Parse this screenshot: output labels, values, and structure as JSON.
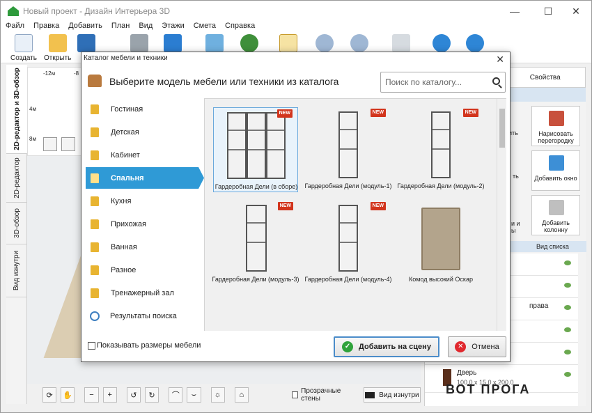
{
  "window": {
    "title": "Новый проект - Дизайн Интерьера 3D"
  },
  "menu": [
    "Файл",
    "Правка",
    "Добавить",
    "План",
    "Вид",
    "Этажи",
    "Смета",
    "Справка"
  ],
  "toolbar": {
    "create": "Создать",
    "open": "Открыть",
    "save_partial": "С"
  },
  "left_tabs": [
    "2D-редактор и 3D-обзор",
    "2D-редактор",
    "3D-обзор",
    "Вид изнутри"
  ],
  "ruler": {
    "x1": "-12м",
    "x2": "-8",
    "y1": "4м",
    "y2": "8м"
  },
  "bottom": {
    "transparent_walls": "Прозрачные стены",
    "inside_view": "Вид изнутри"
  },
  "right_panel": {
    "tab_properties": "Свойства",
    "btn_draw": "Нарисовать перегородку",
    "btn_window": "Добавить окно",
    "btn_column": "Добавить колонну",
    "partial_1": "ить",
    "partial_2": "ть",
    "partial_3": "и и",
    "partial_4": "ы",
    "list_view": "Вид списка",
    "row_partial": "права",
    "door_name": "Дверь",
    "door_size": "100.0 x 15.0 x 200.0"
  },
  "dialog": {
    "title": "Каталог мебели и техники",
    "prompt": "Выберите модель мебели или техники из каталога",
    "search_placeholder": "Поиск по каталогу...",
    "categories": [
      "Гостиная",
      "Детская",
      "Кабинет",
      "Спальня",
      "Кухня",
      "Прихожая",
      "Ванная",
      "Разное",
      "Тренажерный зал",
      "Результаты поиска"
    ],
    "active_category": "Спальня",
    "new_badge": "NEW",
    "items": [
      {
        "name": "Гардеробная Дели (в сборе)",
        "new": true
      },
      {
        "name": "Гардеробная Дели (модуль-1)",
        "new": true
      },
      {
        "name": "Гардеробная Дели (модуль-2)",
        "new": true
      },
      {
        "name": "Гардеробная Дели (модуль-3)",
        "new": true
      },
      {
        "name": "Гардеробная Дели (модуль-4)",
        "new": true
      },
      {
        "name": "Комод высокий Оскар",
        "new": false
      }
    ],
    "show_sizes": "Показывать размеры мебели",
    "add_button": "Добавить на сцену",
    "cancel_button": "Отмена"
  },
  "watermark": "ВОТ ПРОГА"
}
